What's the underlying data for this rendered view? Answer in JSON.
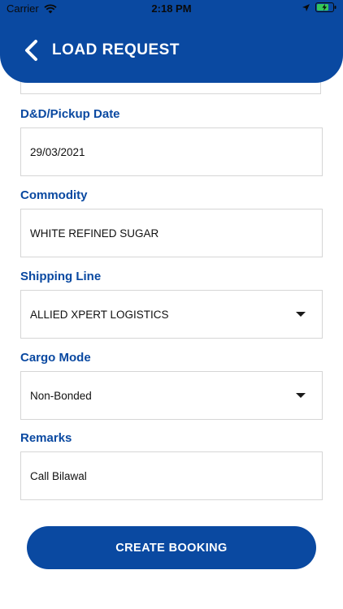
{
  "status_bar": {
    "carrier": "Carrier",
    "time": "2:18 PM"
  },
  "header": {
    "title": "LOAD REQUEST",
    "color": "#0a49a1"
  },
  "form": {
    "pickup_date": {
      "label": "D&D/Pickup Date",
      "value": "29/03/2021"
    },
    "commodity": {
      "label": "Commodity",
      "value": "WHITE REFINED SUGAR"
    },
    "shipping_line": {
      "label": "Shipping Line",
      "value": "ALLIED XPERT LOGISTICS"
    },
    "cargo_mode": {
      "label": "Cargo Mode",
      "value": "Non-Bonded"
    },
    "remarks": {
      "label": "Remarks",
      "value": "Call Bilawal"
    }
  },
  "actions": {
    "create_booking": "CREATE BOOKING"
  },
  "icons": {
    "back": "chevron-left-icon",
    "wifi": "wifi-icon",
    "location": "location-arrow-icon",
    "battery": "battery-charging-icon"
  }
}
